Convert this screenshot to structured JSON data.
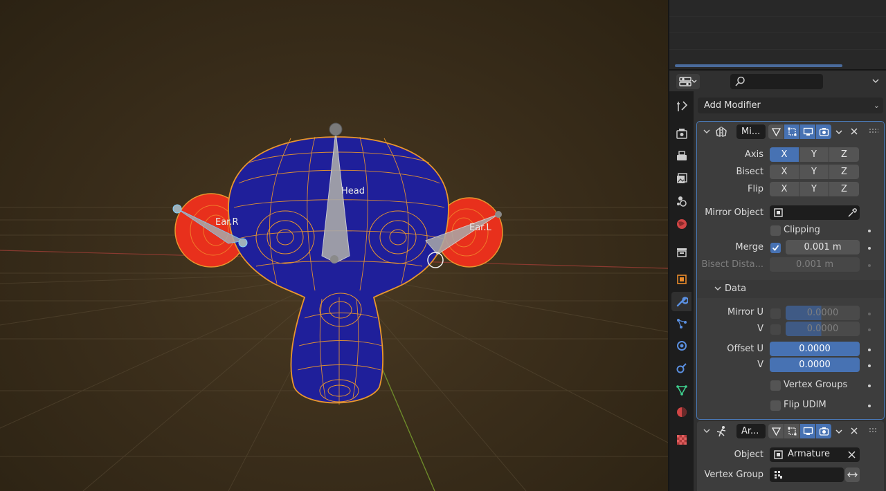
{
  "viewport": {
    "bones": [
      {
        "label": "Head"
      },
      {
        "label": "Ear.R"
      },
      {
        "label": "Ear.L"
      }
    ]
  },
  "header": {
    "search_placeholder": ""
  },
  "tabs": [
    {
      "name": "tool-tab",
      "icon": "tool-icon"
    },
    {
      "name": "render-tab",
      "icon": "render-icon"
    },
    {
      "name": "output-tab",
      "icon": "output-icon"
    },
    {
      "name": "view-layer-tab",
      "icon": "view-layer-icon"
    },
    {
      "name": "scene-tab",
      "icon": "scene-icon"
    },
    {
      "name": "world-tab",
      "icon": "world-icon"
    },
    {
      "name": "collection-tab",
      "icon": "collection-icon"
    },
    {
      "name": "object-tab",
      "icon": "object-icon"
    },
    {
      "name": "modifier-tab",
      "icon": "wrench-icon",
      "active": true
    },
    {
      "name": "particles-tab",
      "icon": "particles-icon"
    },
    {
      "name": "physics-tab",
      "icon": "physics-icon"
    },
    {
      "name": "constraints-tab",
      "icon": "constraints-icon"
    },
    {
      "name": "data-tab",
      "icon": "mesh-data-icon"
    },
    {
      "name": "material-tab",
      "icon": "material-icon"
    },
    {
      "name": "texture-tab",
      "icon": "texture-icon"
    }
  ],
  "add_modifier": {
    "label": "Add Modifier"
  },
  "mirror": {
    "name": "Mi...",
    "axis_label": "Axis",
    "bisect_label": "Bisect",
    "flip_label": "Flip",
    "axes": [
      "X",
      "Y",
      "Z"
    ],
    "axis_active": "X",
    "mirror_object_label": "Mirror Object",
    "mirror_object_value": "",
    "clipping_label": "Clipping",
    "clipping_checked": false,
    "merge_label": "Merge",
    "merge_checked": true,
    "merge_value": "0.001 m",
    "bisect_distance_label": "Bisect Dista...",
    "bisect_distance_value": "0.001 m",
    "data_label": "Data",
    "mirror_u_label": "Mirror U",
    "mirror_u_value": "0.0000",
    "mirror_v_label": "V",
    "mirror_v_value": "0.0000",
    "offset_u_label": "Offset U",
    "offset_u_value": "0.0000",
    "offset_v_label": "V",
    "offset_v_value": "0.0000",
    "vertex_groups_label": "Vertex Groups",
    "flip_udim_label": "Flip UDIM"
  },
  "armature": {
    "name": "Ar...",
    "object_label": "Object",
    "object_value": "Armature",
    "vertex_group_label": "Vertex Group",
    "vertex_group_value": ""
  },
  "colors": {
    "accent": "#4772b3",
    "mesh": "#1f1f9a",
    "weight_red": "#e8301c",
    "wire": "#e8962e"
  }
}
